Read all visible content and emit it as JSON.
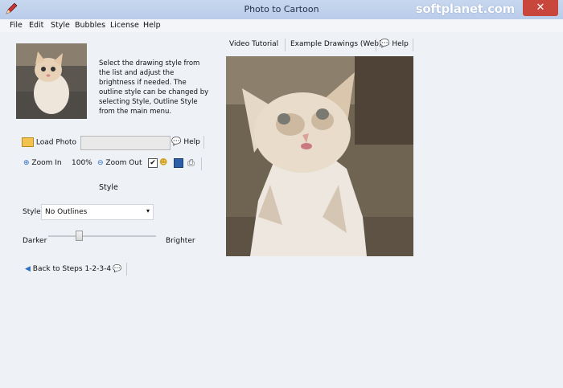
{
  "window": {
    "title": "Photo to Cartoon",
    "watermark": "softplanet.com"
  },
  "menu": [
    "File",
    "Edit",
    "Style",
    "Bubbles",
    "License",
    "Help"
  ],
  "instructions": "Select the drawing style from the list and adjust the brightness if needed. The outline style can be changed by selecting Style, Outline Style from the main menu.",
  "toolbar": {
    "load_photo": "Load Photo",
    "file_field": "",
    "help": "Help",
    "zoom_in": "Zoom In",
    "zoom_level": "100%",
    "zoom_out": "Zoom Out",
    "checkbox_checked": true
  },
  "style_section": {
    "title": "Style",
    "style_label": "Style",
    "style_value": "No Outlines",
    "darker": "Darker",
    "brighter": "Brighter",
    "brightness_level": 0.29
  },
  "back_button": "Back to Steps 1-2-3-4",
  "right_links": {
    "video_tutorial": "Video Tutorial",
    "examples": "Example Drawings (Web)",
    "help": "Help"
  },
  "colors": {
    "titlebar": "#bccfe9",
    "close": "#c9463d",
    "panel": "#eef1f6"
  }
}
